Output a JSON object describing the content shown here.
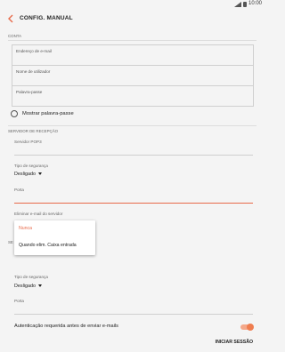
{
  "status_bar": {
    "time": "10:00",
    "signal_icon": "signal-icon",
    "battery_icon": "battery-icon"
  },
  "app_bar": {
    "title": "CONFIG. MANUAL",
    "back_icon": "back-arrow-icon",
    "accent": "#e86a4a"
  },
  "account_section": {
    "header": "CONTA",
    "fields": [
      {
        "label": "Endereço de e-mail"
      },
      {
        "label": "Nome de utilizador"
      },
      {
        "label": "Palavra-passe"
      }
    ],
    "show_password_label": "Mostrar palavra-passe"
  },
  "incoming_section": {
    "header": "SERVIDOR DE RECEPÇÃO",
    "server_label": "Servidor POP3",
    "security_label": "Tipo de segurança",
    "security_value": "Desligado",
    "port_label": "Porta",
    "delete_label": "Eliminar e-mail do servidor"
  },
  "delete_popup": {
    "options": [
      {
        "label": "Nunca",
        "selected": true
      },
      {
        "label": "Quando elim. Caixa entrada",
        "selected": false
      }
    ]
  },
  "outgoing_section": {
    "header": "SE",
    "security_label": "Tipo de segurança",
    "security_value": "Desligado",
    "port_label": "Porta",
    "auth_label": "Autenticação requerida antes de enviar e-mails",
    "auth_enabled": true
  },
  "footer": {
    "sign_in_label": "INICIAR SESSÃO"
  }
}
